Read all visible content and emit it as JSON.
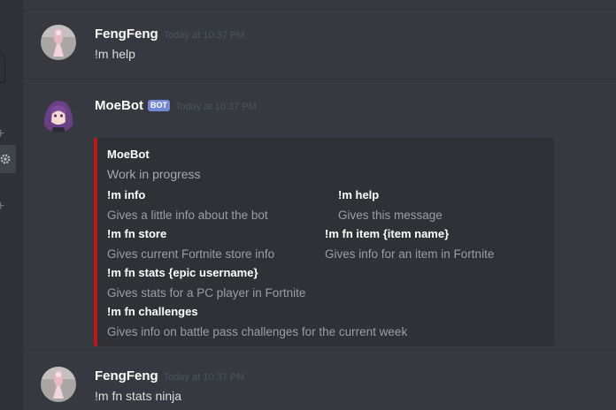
{
  "messages": [
    {
      "author": "FengFeng",
      "timestamp": "Today at 10:37 PM",
      "content": "!m help"
    },
    {
      "author": "MoeBot",
      "bot_tag": "BOT",
      "timestamp": "Today at 10:37 PM",
      "embed": {
        "accent_color": "#c2151a",
        "title": "MoeBot",
        "description": "Work in progress",
        "fields": [
          {
            "name": "!m info",
            "value": "Gives a little info about the bot"
          },
          {
            "name": "!m help",
            "value": "Gives this message"
          },
          {
            "name": "!m fn store",
            "value": "Gives current Fortnite store info"
          },
          {
            "name": "!m fn item {item name}",
            "value": "Gives info for an item in Fortnite"
          },
          {
            "name": "!m fn stats {epic username}",
            "value": "Gives stats for a PC player in Fortnite"
          },
          {
            "name": "!m fn challenges",
            "value": "Gives info on battle pass challenges for the current week"
          }
        ]
      }
    },
    {
      "author": "FengFeng",
      "timestamp": "Today at 10:37 PM",
      "content": "!m fn stats ninja"
    }
  ],
  "sidebar": {
    "icons": [
      "plus-icon",
      "gear-icon",
      "plus-icon"
    ]
  },
  "colors": {
    "background": "#36393f",
    "sidebar": "#2f3136",
    "bot_tag": "#7289da",
    "embed_accent": "#c2151a"
  }
}
